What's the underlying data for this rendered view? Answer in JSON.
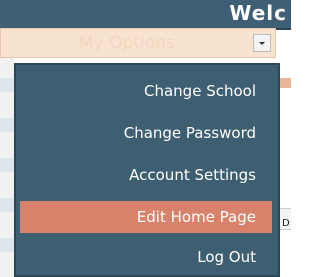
{
  "header": {
    "welcome_text": "Welc"
  },
  "options": {
    "label": "My Options"
  },
  "background": {
    "edge_letter": "D"
  },
  "menu": {
    "items": [
      {
        "label": "Change School"
      },
      {
        "label": "Change Password"
      },
      {
        "label": "Account Settings"
      },
      {
        "label": "Edit Home Page"
      },
      {
        "label": "Log Out"
      }
    ],
    "active_index": 3
  },
  "colors": {
    "header": "#3f5f74",
    "options_bg": "#f7e3cf",
    "menu_bg": "#3e5e71",
    "active_item": "#d9826b"
  },
  "icons": {
    "options_arrow": "chevron-down-icon"
  }
}
